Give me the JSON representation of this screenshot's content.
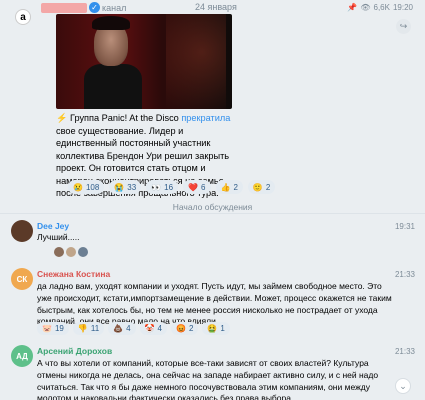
{
  "channel": {
    "avatar_letter": "a",
    "type_label": "канал",
    "date": "24 января",
    "views": "6,6K",
    "time": "19:20",
    "pin_icon": "pin-icon",
    "share_icon": "share-icon"
  },
  "post": {
    "text_before_link": "⚡️ Группа Panic! At the Disco ",
    "link_text": "прекратила",
    "text_after_link": " свое существование. Лидер и единственный постоянный участник коллектива Брендон Ури решил закрыть проект. Он готовится стать отцом и намерен сконцентрироваться на семье после завершения прощального тура.",
    "reactions": [
      {
        "emoji": "😢",
        "count": "108",
        "selected": false
      },
      {
        "emoji": "😭",
        "count": "33",
        "selected": false
      },
      {
        "emoji": "👀",
        "count": "16",
        "selected": false
      },
      {
        "emoji": "❤️",
        "count": "6",
        "selected": false
      },
      {
        "emoji": "👍",
        "count": "2",
        "selected": false
      },
      {
        "emoji": "🙂",
        "count": "2",
        "selected": false
      }
    ]
  },
  "discussion": {
    "start_label": "Начало обсуждения"
  },
  "comments": [
    {
      "author": "Dee Jey",
      "author_color": "#3390ec",
      "avatar_text": "",
      "avatar_color": "#5b3a28",
      "time": "19:31",
      "text": "Лучший.....",
      "reactions": []
    },
    {
      "author": "Снежана Костина",
      "author_color": "#d9534f",
      "avatar_text": "СК",
      "avatar_color": "#f0a84f",
      "time": "21:33",
      "text": "да ладно вам, уходят компании и уходят. Пусть идут, мы займем свободное место. Это уже происходит, кстати,импортзамещение в действии. Может, процесс окажется не таким быстрым, как хотелось бы, но тем не менее россия нисколько не пострадает от ухода компаний. они все равно мало на что влияли",
      "reactions": [
        {
          "emoji": "🐷",
          "count": "19"
        },
        {
          "emoji": "👎",
          "count": "11"
        },
        {
          "emoji": "💩",
          "count": "4"
        },
        {
          "emoji": "🤡",
          "count": "4"
        },
        {
          "emoji": "😡",
          "count": "2"
        },
        {
          "emoji": "🤮",
          "count": "1"
        }
      ]
    },
    {
      "author": "Арсений Дорохов",
      "author_color": "#3aa372",
      "avatar_text": "АД",
      "avatar_color": "#5ec08a",
      "time": "21:33",
      "text": "А что вы хотели от компаний, которые все-таки зависят от своих властей? Культура отмены никогда не делась, она сейчас на западе набирает активно силу, и с ней надо считаться. Так что я бы даже немного посочувствовала этим компаниям, они между молотом и наковальни фактически оказались без права выбора.",
      "reactions": []
    }
  ],
  "scroll_down_icon": "chevron-down-icon"
}
